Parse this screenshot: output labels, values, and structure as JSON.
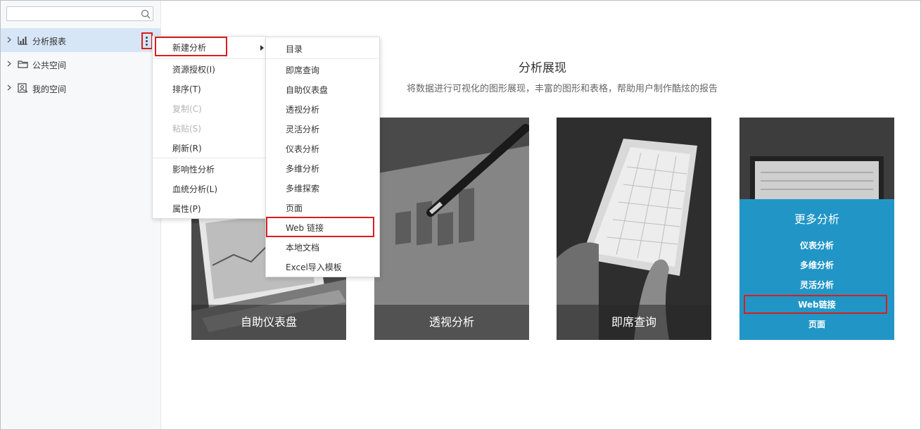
{
  "search": {
    "value": "",
    "placeholder": ""
  },
  "sidebar": {
    "items": [
      {
        "label": "分析报表",
        "icon": "chart-icon",
        "active": true
      },
      {
        "label": "公共空间",
        "icon": "folder-icon",
        "active": false
      },
      {
        "label": "我的空间",
        "icon": "user-space-icon",
        "active": false
      }
    ]
  },
  "main": {
    "title": "分析展现",
    "description": "将数据进行可视化的图形展现，丰富的图形和表格，帮助用户制作酷炫的报告",
    "cards": [
      {
        "caption": "自助仪表盘",
        "image": "laptop-dashboard-photo"
      },
      {
        "caption": "透视分析",
        "image": "pen-chart-photo"
      },
      {
        "caption": "即席查询",
        "image": "tablet-table-photo"
      }
    ],
    "more_card": {
      "title": "更多分析",
      "links": [
        "仪表分析",
        "多维分析",
        "灵活分析",
        "Web链接",
        "页面"
      ]
    }
  },
  "context_menu": {
    "items": [
      {
        "label": "新建分析",
        "disabled": false,
        "submenu": true
      },
      {
        "label": "资源授权(I)",
        "disabled": false
      },
      {
        "label": "排序(T)",
        "disabled": false
      },
      {
        "label": "复制(C)",
        "disabled": true
      },
      {
        "label": "粘贴(S)",
        "disabled": true
      },
      {
        "label": "刷新(R)",
        "disabled": false
      },
      {
        "label": "影响性分析",
        "disabled": false
      },
      {
        "label": "血统分析(L)",
        "disabled": false
      },
      {
        "label": "属性(P)",
        "disabled": false
      }
    ]
  },
  "submenu": {
    "items": [
      "目录",
      "即席查询",
      "自助仪表盘",
      "透视分析",
      "灵活分析",
      "仪表分析",
      "多维分析",
      "多维探索",
      "页面",
      "Web 链接",
      "本地文档",
      "Excel导入模板"
    ]
  },
  "colors": {
    "accent": "#2196c6",
    "highlight_box": "#d81e1e",
    "active_item_bg": "#d7e6f7",
    "sidebar_bg": "#f7f8fa"
  }
}
